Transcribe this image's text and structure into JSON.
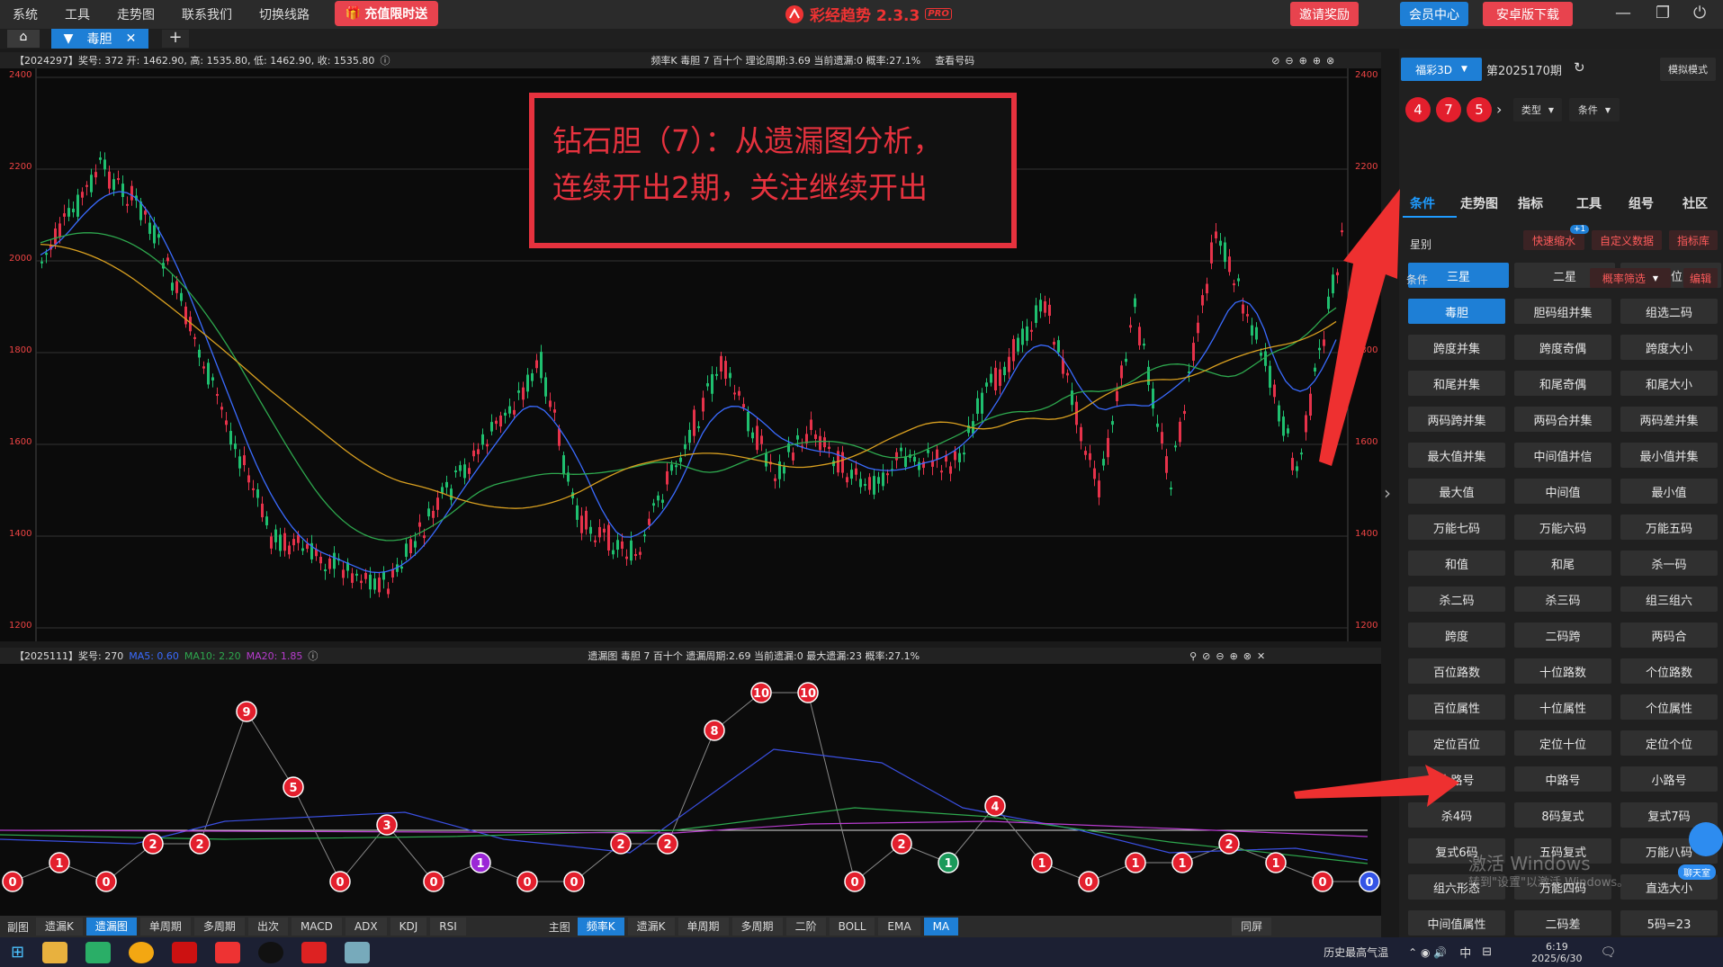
{
  "menu": [
    "系统",
    "工具",
    "走势图",
    "联系我们",
    "切换线路"
  ],
  "recharge": "充值限时送",
  "app_title": "彩经趋势 2.3.3",
  "app_badge": "PRO",
  "top_buttons": {
    "invite": "邀请奖励",
    "member": "会员中心",
    "android": "安卓版下载"
  },
  "tabs": {
    "active": "毒胆"
  },
  "chart1": {
    "info_left": "【2024297】奖号: 372  开: 1462.90, 高: 1535.80, 低: 1462.90, 收: 1535.80",
    "info_mid": "频率K  毒胆  7  百十个  理论周期:3.69  当前遗漏:0  概率:27.1%",
    "info_btn": "查看号码",
    "yaxis": [
      "2400",
      "2200",
      "2000",
      "1800",
      "1600",
      "1400",
      "1200"
    ]
  },
  "annotation": {
    "line1": "钻石胆（7）：从遗漏图分析，",
    "line2": "连续开出2期，关注继续开出"
  },
  "chart2": {
    "info_left": "【2025111】奖号: 270",
    "ma5": "MA5: 0.60",
    "ma10": "MA10: 2.20",
    "ma20": "MA20: 1.85",
    "info_mid": "遗漏图  毒胆  7  百十个  遗漏周期:2.69  当前遗漏:0  最大遗漏:23  概率:27.1%"
  },
  "chart_data": {
    "type": "line",
    "title": "遗漏图",
    "x": [
      1,
      2,
      3,
      4,
      5,
      6,
      7,
      8,
      9,
      10,
      11,
      12,
      13,
      14,
      15,
      16,
      17,
      18,
      19,
      20,
      21,
      22,
      23,
      24,
      25,
      26,
      27,
      28,
      29,
      30
    ],
    "values": [
      0,
      1,
      0,
      2,
      2,
      9,
      5,
      0,
      3,
      0,
      1,
      0,
      0,
      2,
      2,
      8,
      10,
      10,
      0,
      2,
      1,
      4,
      1,
      0,
      1,
      1,
      2,
      1,
      0,
      0
    ],
    "ball_colors": [
      "red",
      "red",
      "red",
      "red",
      "red",
      "red",
      "red",
      "red",
      "red",
      "red",
      "purple",
      "red",
      "red",
      "red",
      "red",
      "red",
      "red",
      "red",
      "red",
      "red",
      "green",
      "red",
      "red",
      "red",
      "red",
      "red",
      "red",
      "red",
      "red",
      "blue"
    ]
  },
  "bottom_tabs": {
    "sub_label": "副图",
    "sub": [
      "遗漏K",
      "遗漏图",
      "单周期",
      "多周期",
      "出次",
      "MACD",
      "ADX",
      "KDJ",
      "RSI"
    ],
    "sub_active": "遗漏图",
    "main_label": "主图",
    "main": [
      "频率K",
      "遗漏K",
      "单周期",
      "多周期",
      "二阶",
      "BOLL",
      "EMA",
      "MA"
    ],
    "main_active_1": "频率K",
    "main_active_2": "MA",
    "fullscreen": "同屏"
  },
  "right": {
    "lottery": "福彩3D",
    "period": "第2025170期",
    "sim": "模拟模式",
    "balls": [
      "4",
      "7",
      "5"
    ],
    "type": "类型",
    "cond": "条件",
    "tabs": [
      "条件",
      "走势图",
      "指标",
      "工具",
      "组号",
      "社区"
    ],
    "category": "星别",
    "tags": [
      "快速缩水",
      "自定义数据",
      "指标库"
    ],
    "badge": "+1",
    "stars": [
      "三星",
      "二星",
      "定位"
    ],
    "cond_label": "条件",
    "filter": "概率筛选",
    "edit": "编辑",
    "grid": [
      "毒胆",
      "胆码组并集",
      "组选二码",
      "跨度并集",
      "跨度奇偶",
      "跨度大小",
      "和尾并集",
      "和尾奇偶",
      "和尾大小",
      "两码跨并集",
      "两码合并集",
      "两码差并集",
      "最大值并集",
      "中间值并信",
      "最小值并集",
      "最大值",
      "中间值",
      "最小值",
      "万能七码",
      "万能六码",
      "万能五码",
      "和值",
      "和尾",
      "杀一码",
      "杀二码",
      "杀三码",
      "组三组六",
      "跨度",
      "二码跨",
      "两码合",
      "百位路数",
      "十位路数",
      "个位路数",
      "百位属性",
      "十位属性",
      "个位属性",
      "定位百位",
      "定位十位",
      "定位个位",
      "大路号",
      "中路号",
      "小路号",
      "杀4码",
      "8码复式",
      "复式7码",
      "复式6码",
      "五码复式",
      "万能八码",
      "组六形态",
      "万能四码",
      "直选大小",
      "中间值属性",
      "二码差",
      "5码=23"
    ]
  },
  "watermark": {
    "l1": "激活 Windows",
    "l2": "转到\"设置\"以激活 Windows。"
  },
  "chat": "聊天室",
  "taskbar": {
    "weather": "历史最高气温",
    "time": "6:19",
    "date": "2025/6/30",
    "ime": "中"
  }
}
